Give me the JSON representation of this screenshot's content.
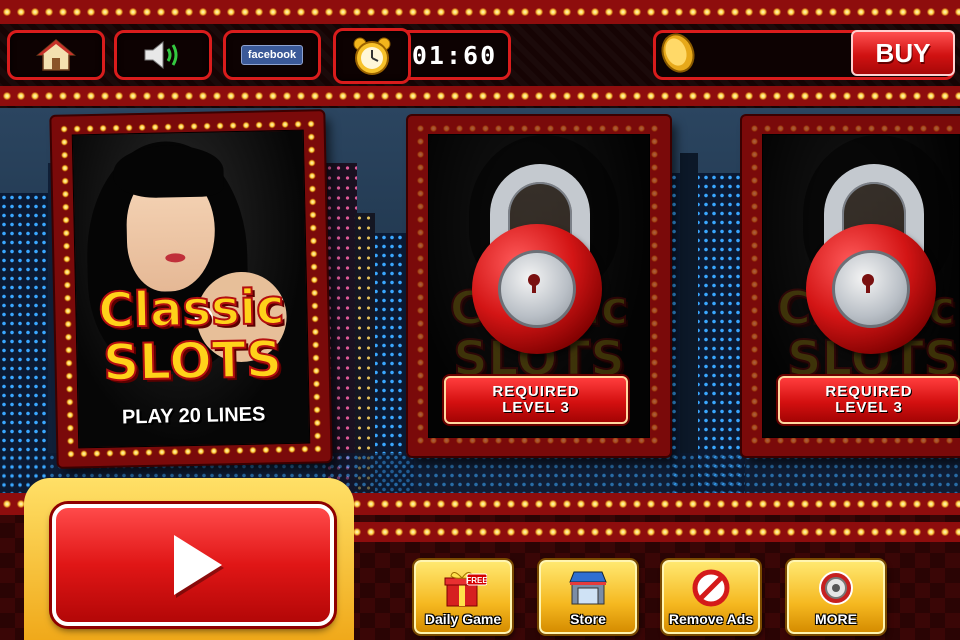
{
  "header": {
    "home_icon": "house-icon",
    "sound_icon": "speaker-icon",
    "facebook_label": "facebook",
    "alarm_icon": "alarm-clock-icon",
    "timer": "01:60",
    "coin_icon": "gold-coin-icon",
    "buy_label": "BUY"
  },
  "slots": [
    {
      "title_line1": "Classic",
      "title_line2": "SLOTS",
      "subtitle": "PLAY 20 LINES",
      "locked": false
    },
    {
      "title_line1": "Classic",
      "title_line2": "SLOTS",
      "requirement_line1": "REQUIRED",
      "requirement_line2": "LEVEL 3",
      "locked": true
    },
    {
      "title_line1": "Classic",
      "title_line2": "SLOTS",
      "requirement_line1": "REQUIRED",
      "requirement_line2": "LEVEL 3",
      "locked": true
    }
  ],
  "footer": {
    "play_icon": "play-icon",
    "buttons": [
      {
        "label": "Daily Game",
        "icon": "gift-icon",
        "badge": "FREE"
      },
      {
        "label": "Store",
        "icon": "store-icon"
      },
      {
        "label": "Remove Ads",
        "icon": "no-ads-icon"
      },
      {
        "label": "MORE",
        "icon": "more-icon"
      }
    ]
  },
  "colors": {
    "accent_red": "#d91c1c",
    "gold": "#ffd21a",
    "bulb": "#ffd54a"
  }
}
